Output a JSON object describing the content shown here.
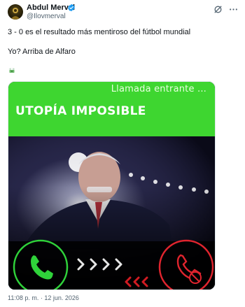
{
  "author": {
    "display_name": "Abdul Merval",
    "handle": "@Ilovmerval",
    "verified_color": "#1d9bf0"
  },
  "tweet": {
    "line1": "3 - 0 es el resultado más mentiroso del fútbol mundial",
    "line2": "Yo? Arriba de Alfaro",
    "emoji": "money-with-wings-emoji",
    "timestamp": "11:08 p. m. · 12 jun. 2026"
  },
  "media": {
    "incoming_call_text": "Llamada entrante ...",
    "banner_text": "UTOPÍA IMPOSIBLE",
    "banner_color": "#3ed630",
    "accept_color": "#2fd23a",
    "decline_color": "#e0242e"
  },
  "icons": {
    "grok": "grok-icon",
    "more": "more-icon"
  }
}
